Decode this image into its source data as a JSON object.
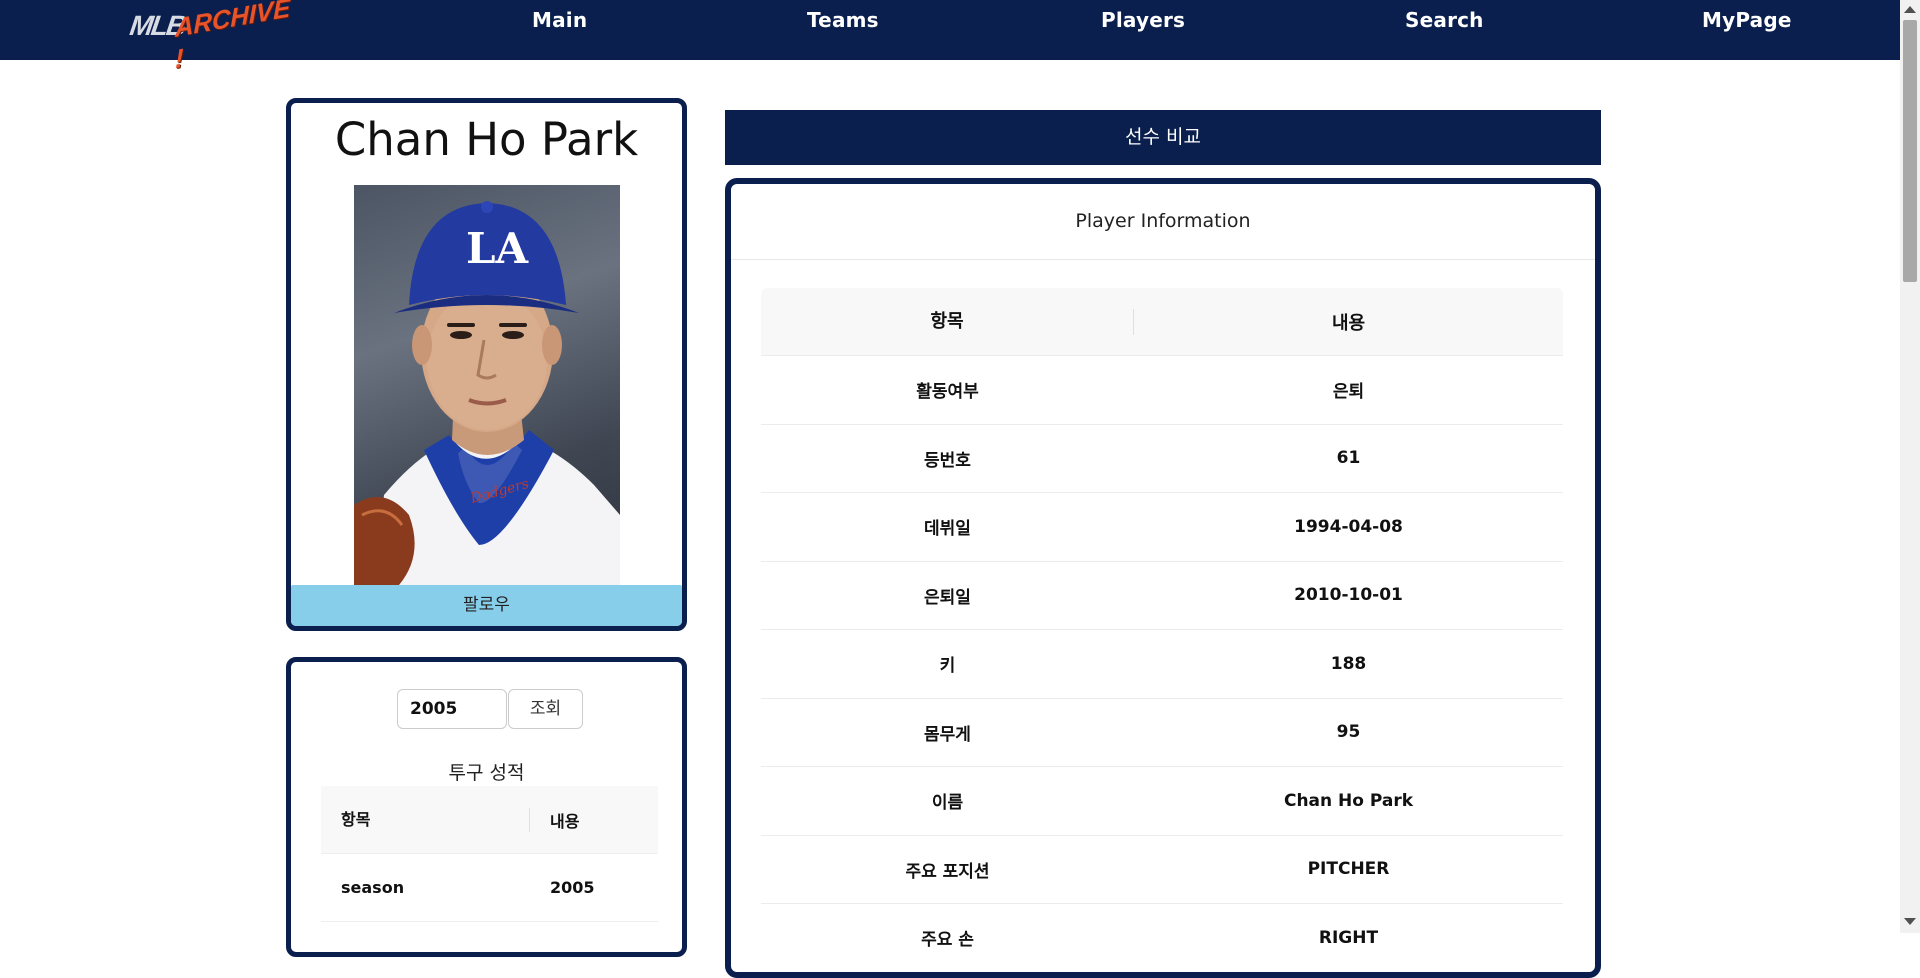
{
  "nav": {
    "logo_mlb": "MLB",
    "logo_archive": "ARCHIVE !",
    "items": [
      "Main",
      "Teams",
      "Players",
      "Search",
      "MyPage"
    ]
  },
  "profile": {
    "name": "Chan Ho Park",
    "follow_label": "팔로우"
  },
  "stats": {
    "year_value": "2005",
    "lookup_label": "조회",
    "section_title": "투구 성적",
    "headers": [
      "항목",
      "내용"
    ],
    "rows": [
      [
        "season",
        "2005"
      ]
    ]
  },
  "compare_label": "선수 비교",
  "info": {
    "title": "Player Information",
    "headers": [
      "항목",
      "내용"
    ],
    "rows": [
      [
        "활동여부",
        "은퇴"
      ],
      [
        "등번호",
        "61"
      ],
      [
        "데뷔일",
        "1994-04-08"
      ],
      [
        "은퇴일",
        "2010-10-01"
      ],
      [
        "키",
        "188"
      ],
      [
        "몸무게",
        "95"
      ],
      [
        "이름",
        "Chan Ho Park"
      ],
      [
        "주요 포지션",
        "PITCHER"
      ],
      [
        "주요 손",
        "RIGHT"
      ]
    ]
  },
  "colors": {
    "navy": "#0a1f4d",
    "follow_bg": "#87ceeb",
    "logo_accent": "#e8542a"
  }
}
